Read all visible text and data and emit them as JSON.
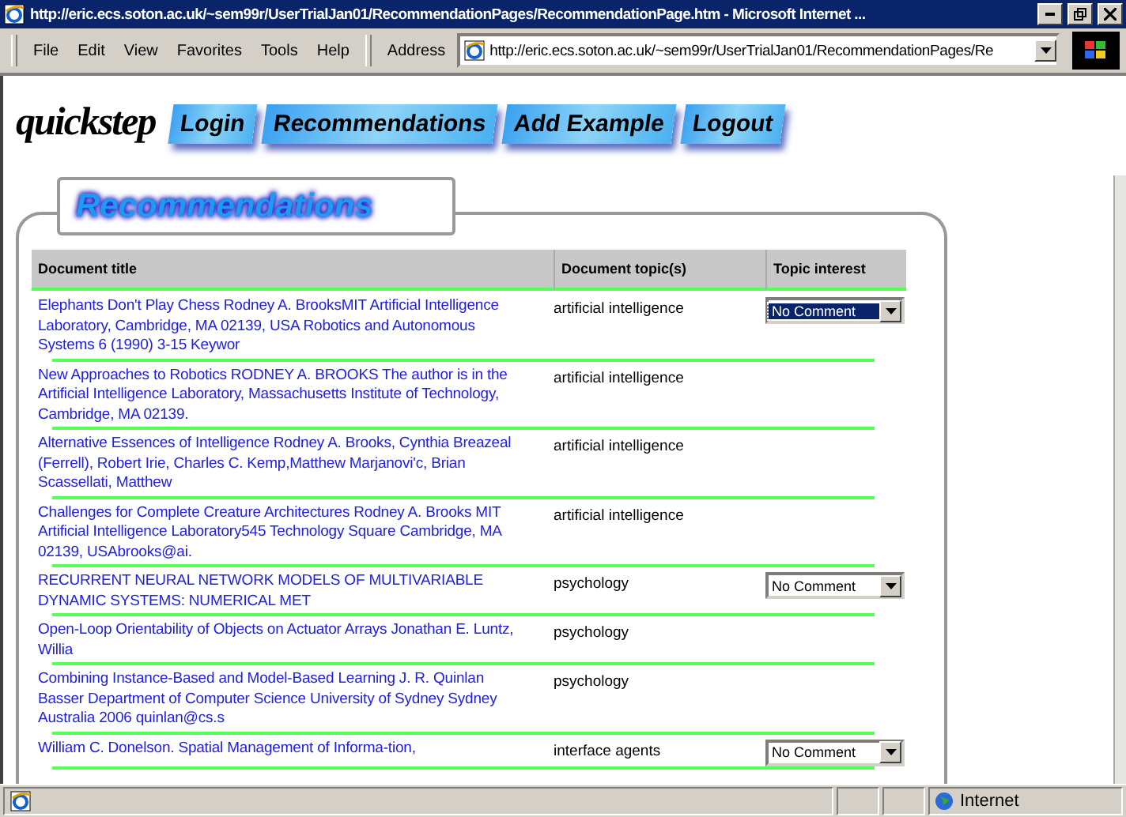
{
  "window": {
    "title": "http://eric.ecs.soton.ac.uk/~sem99r/UserTrialJan01/RecommendationPages/RecommendationPage.htm - Microsoft Internet ..."
  },
  "menu": [
    "File",
    "Edit",
    "View",
    "Favorites",
    "Tools",
    "Help"
  ],
  "address": {
    "label": "Address",
    "value": "http://eric.ecs.soton.ac.uk/~sem99r/UserTrialJan01/RecommendationPages/Re"
  },
  "logo": "quickstep",
  "nav": [
    "Login",
    "Recommendations",
    "Add Example",
    "Logout"
  ],
  "panel_title": "Recommendations",
  "table": {
    "columns": [
      "Document title",
      "Document topic(s)",
      "Topic interest"
    ],
    "rows": [
      {
        "title": "Elephants Don't Play Chess Rodney A. BrooksMIT Artificial Intelligence Laboratory, Cambridge, MA 02139, USA Robotics and Autonomous Systems 6 (1990) 3-15 Keywor",
        "topic": "artificial intelligence",
        "interest": {
          "value": "No Comment",
          "focused": true
        }
      },
      {
        "title": "New Approaches to Robotics RODNEY A. BROOKS The author is in the Artificial Intelligence Laboratory, Massachusetts Institute of Technology, Cambridge, MA 02139.",
        "topic": "artificial intelligence"
      },
      {
        "title": "Alternative Essences of Intelligence Rodney A. Brooks, Cynthia Breazeal (Ferrell), Robert Irie, Charles C. Kemp,Matthew Marjanovi'c, Brian Scassellati, Matthew",
        "topic": "artificial intelligence"
      },
      {
        "title": "Challenges for Complete Creature Architectures  Rodney A. Brooks MIT Artificial Intelligence Laboratory545 Technology Square Cambridge, MA 02139, USAbrooks@ai.",
        "topic": "artificial intelligence"
      },
      {
        "title": "RECURRENT NEURAL NETWORK MODELS OF MULTIVARIABLE DYNAMIC SYSTEMS: NUMERICAL  MET",
        "topic": "psychology",
        "interest": {
          "value": "No Comment",
          "focused": false
        }
      },
      {
        "title": "Open-Loop Orientability of Objects on Actuator Arrays  Jonathan E. Luntz, Willia",
        "topic": "psychology"
      },
      {
        "title": "Combining Instance-Based and Model-Based Learning  J. R. Quinlan Basser Department of Computer Science  University of Sydney Sydney Australia 2006  quinlan@cs.s",
        "topic": "psychology"
      },
      {
        "title": "William  C.  Donelson.  Spatial  Management  of  Informa-tion,",
        "topic": "interface agents",
        "interest": {
          "value": "No Comment",
          "focused": false
        }
      }
    ]
  },
  "status_bar": {
    "zone": "Internet"
  }
}
